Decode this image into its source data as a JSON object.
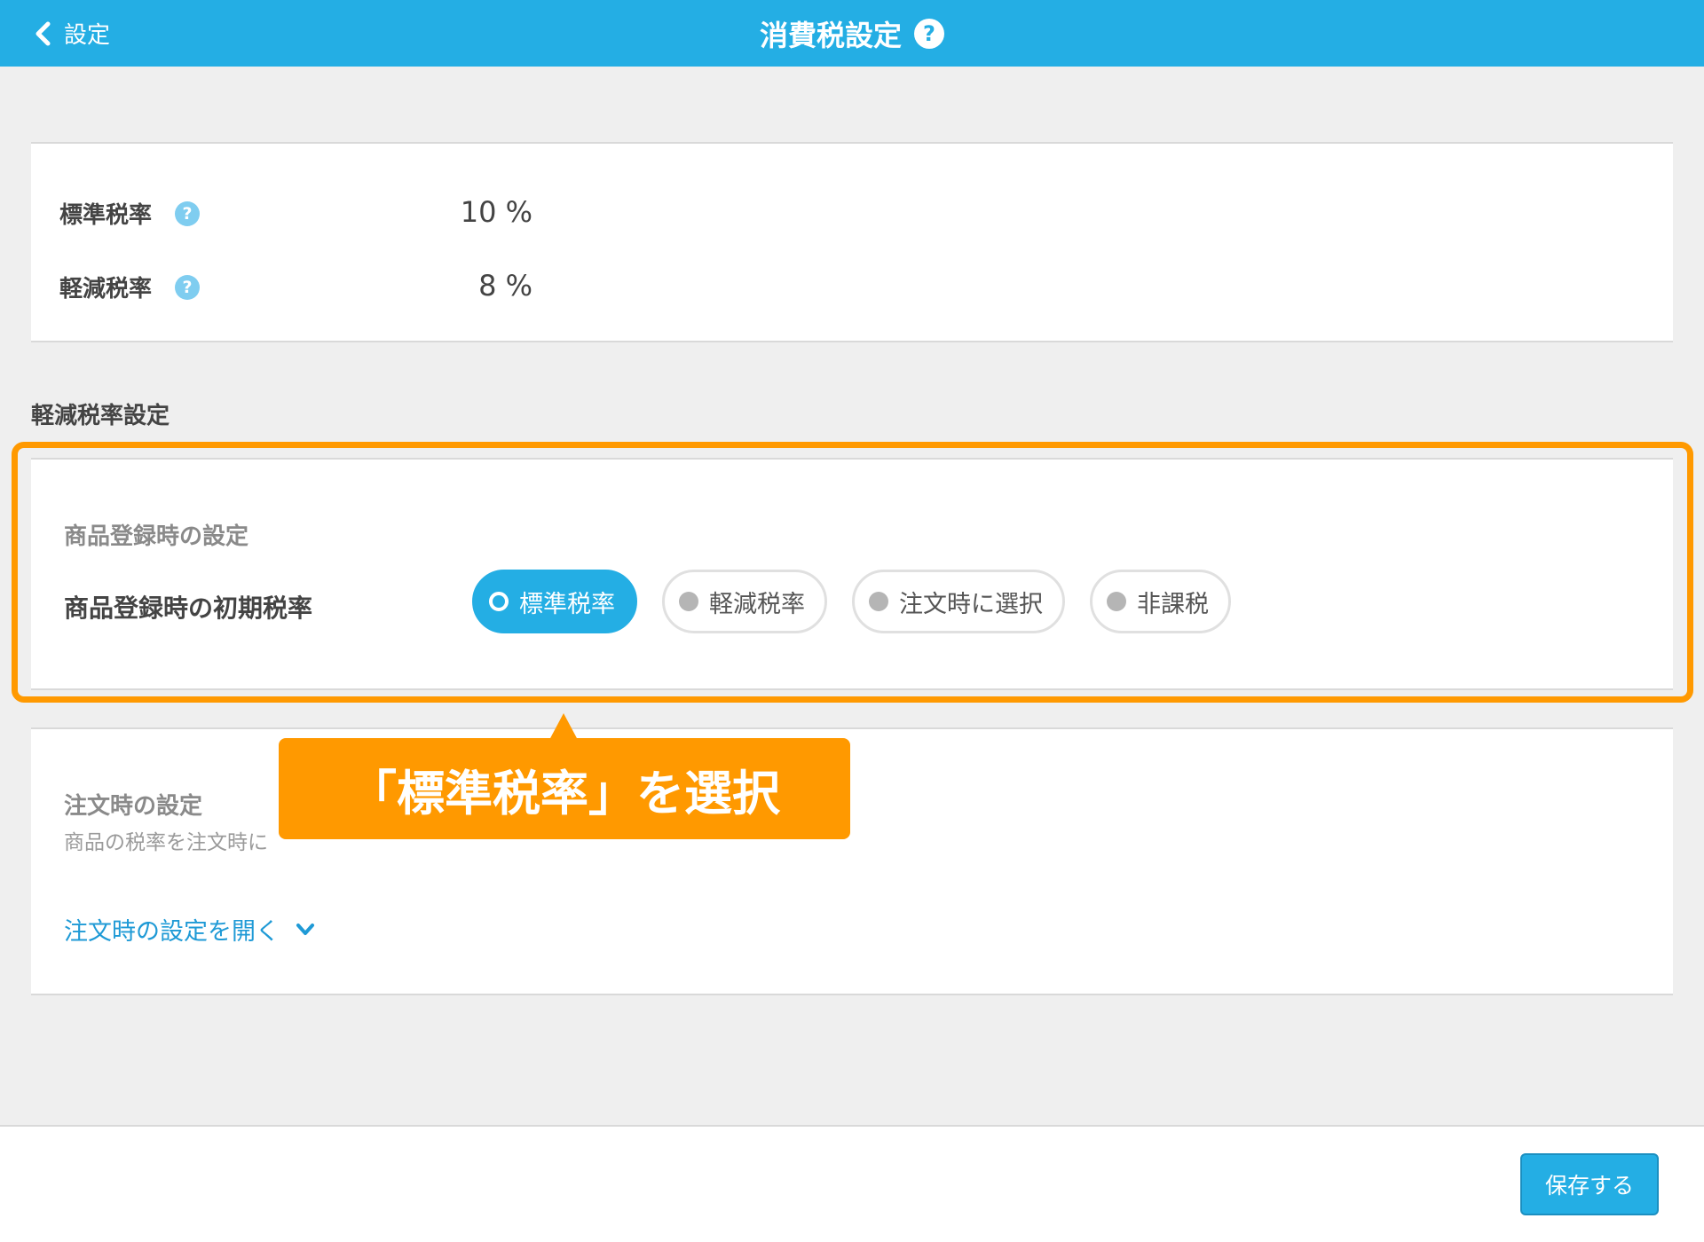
{
  "header": {
    "back_label": "設定",
    "title": "消費税設定",
    "help_icon": "?"
  },
  "rates": [
    {
      "label": "標準税率",
      "help_icon": "?",
      "value": "10 %"
    },
    {
      "label": "軽減税率",
      "help_icon": "?",
      "value": "8 %"
    }
  ],
  "reduced_section": {
    "title": "軽減税率設定",
    "product": {
      "heading": "商品登録時の設定",
      "field_label": "商品登録時の初期税率",
      "options": [
        "標準税率",
        "軽減税率",
        "注文時に選択",
        "非課税"
      ],
      "selected": "標準税率"
    },
    "order": {
      "heading": "注文時の設定",
      "description": "商品の税率を注文時に",
      "toggle_label": "注文時の設定を開く"
    }
  },
  "callout": {
    "text": "「標準税率」を選択"
  },
  "footer": {
    "save_label": "保存する"
  },
  "colors": {
    "primary": "#24aee4",
    "highlight": "#ff9900",
    "link": "#1f9ad6"
  }
}
